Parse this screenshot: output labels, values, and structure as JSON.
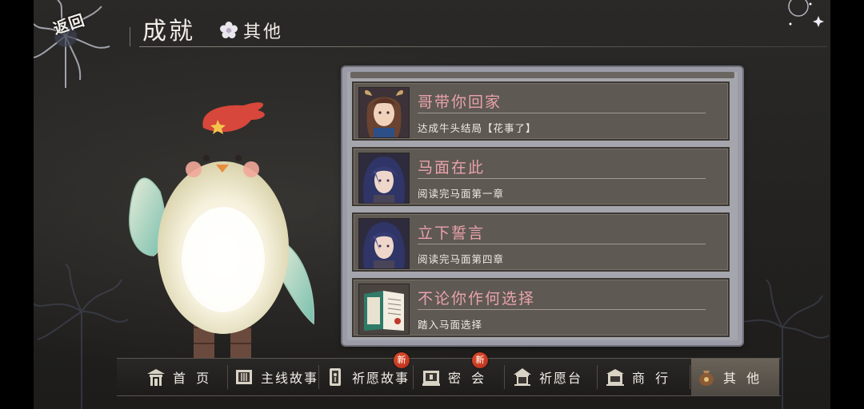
{
  "header": {
    "back_label": "返回",
    "title": "成就",
    "tab_label": "其他"
  },
  "achievements": [
    {
      "title": "哥带你回家",
      "desc": "达成牛头结局【花事了】",
      "portrait": "niutou-avatar-icon"
    },
    {
      "title": "马面在此",
      "desc": "阅读完马面第一章",
      "portrait": "mamian-avatar-icon"
    },
    {
      "title": "立下誓言",
      "desc": "阅读完马面第四章",
      "portrait": "mamian-avatar-icon"
    },
    {
      "title": "不论你作何选择",
      "desc": "踏入马面选择",
      "portrait": "book-icon"
    }
  ],
  "bottom_nav": {
    "items": [
      {
        "label": "首 页",
        "icon": "home-gate-icon",
        "badge": ""
      },
      {
        "label": "主线故事",
        "icon": "scroll-book-icon",
        "badge": ""
      },
      {
        "label": "祈愿故事",
        "icon": "talisman-icon",
        "badge": "新"
      },
      {
        "label": "密 会",
        "icon": "meeting-frame-icon",
        "badge": "新"
      },
      {
        "label": "祈愿台",
        "icon": "pavilion-icon",
        "badge": ""
      },
      {
        "label": "商 行",
        "icon": "shop-icon",
        "badge": ""
      },
      {
        "label": "其 他",
        "icon": "pouch-icon",
        "badge": ""
      }
    ],
    "active_index": 6
  },
  "colors": {
    "accent_pink": "#e8a3ab",
    "panel": "#9a9ba6",
    "badge_red": "#c9361f"
  }
}
